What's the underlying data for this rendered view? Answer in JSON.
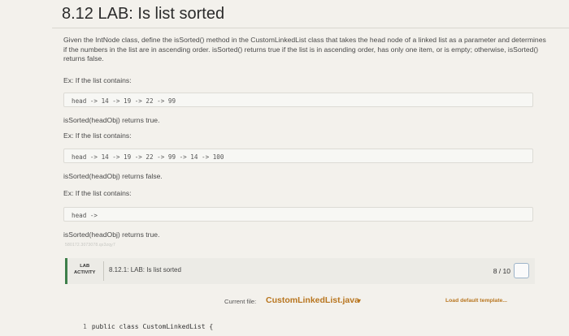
{
  "title": "8.12 LAB: Is list sorted",
  "intro": "Given the IntNode class, define the isSorted() method in the CustomLinkedList class that takes the head node of a linked list as a parameter and determines if the numbers in the list are in ascending order. isSorted() returns true if the list is in ascending order, has only one item, or is empty; otherwise, isSorted() returns false.",
  "examples": [
    {
      "label": "Ex: If the list contains:",
      "code": "head -> 14 -> 19 -> 22 -> 99",
      "result": "isSorted(headObj) returns true."
    },
    {
      "label": "Ex: If the list contains:",
      "code": "head -> 14 -> 19 -> 22 -> 99 -> 14 -> 100",
      "result": "isSorted(headObj) returns false."
    },
    {
      "label": "Ex: If the list contains:",
      "code": "head ->",
      "result": "isSorted(headObj) returns true."
    }
  ],
  "faded_text": "580172.3073078.qx3zqy7",
  "activity": {
    "label_line1": "LAB",
    "label_line2": "ACTIVITY",
    "title": "8.12.1: LAB: Is list sorted",
    "score": "8 / 10"
  },
  "file": {
    "label": "Current file:",
    "name": "CustomLinkedList.java",
    "caret": "▾",
    "load_template": "Load default template..."
  },
  "editor": {
    "line_number": "1",
    "line_text": "public class CustomLinkedList {"
  },
  "colors": {
    "accent": "#b8751e",
    "activity_bar": "#3d7f4a"
  }
}
